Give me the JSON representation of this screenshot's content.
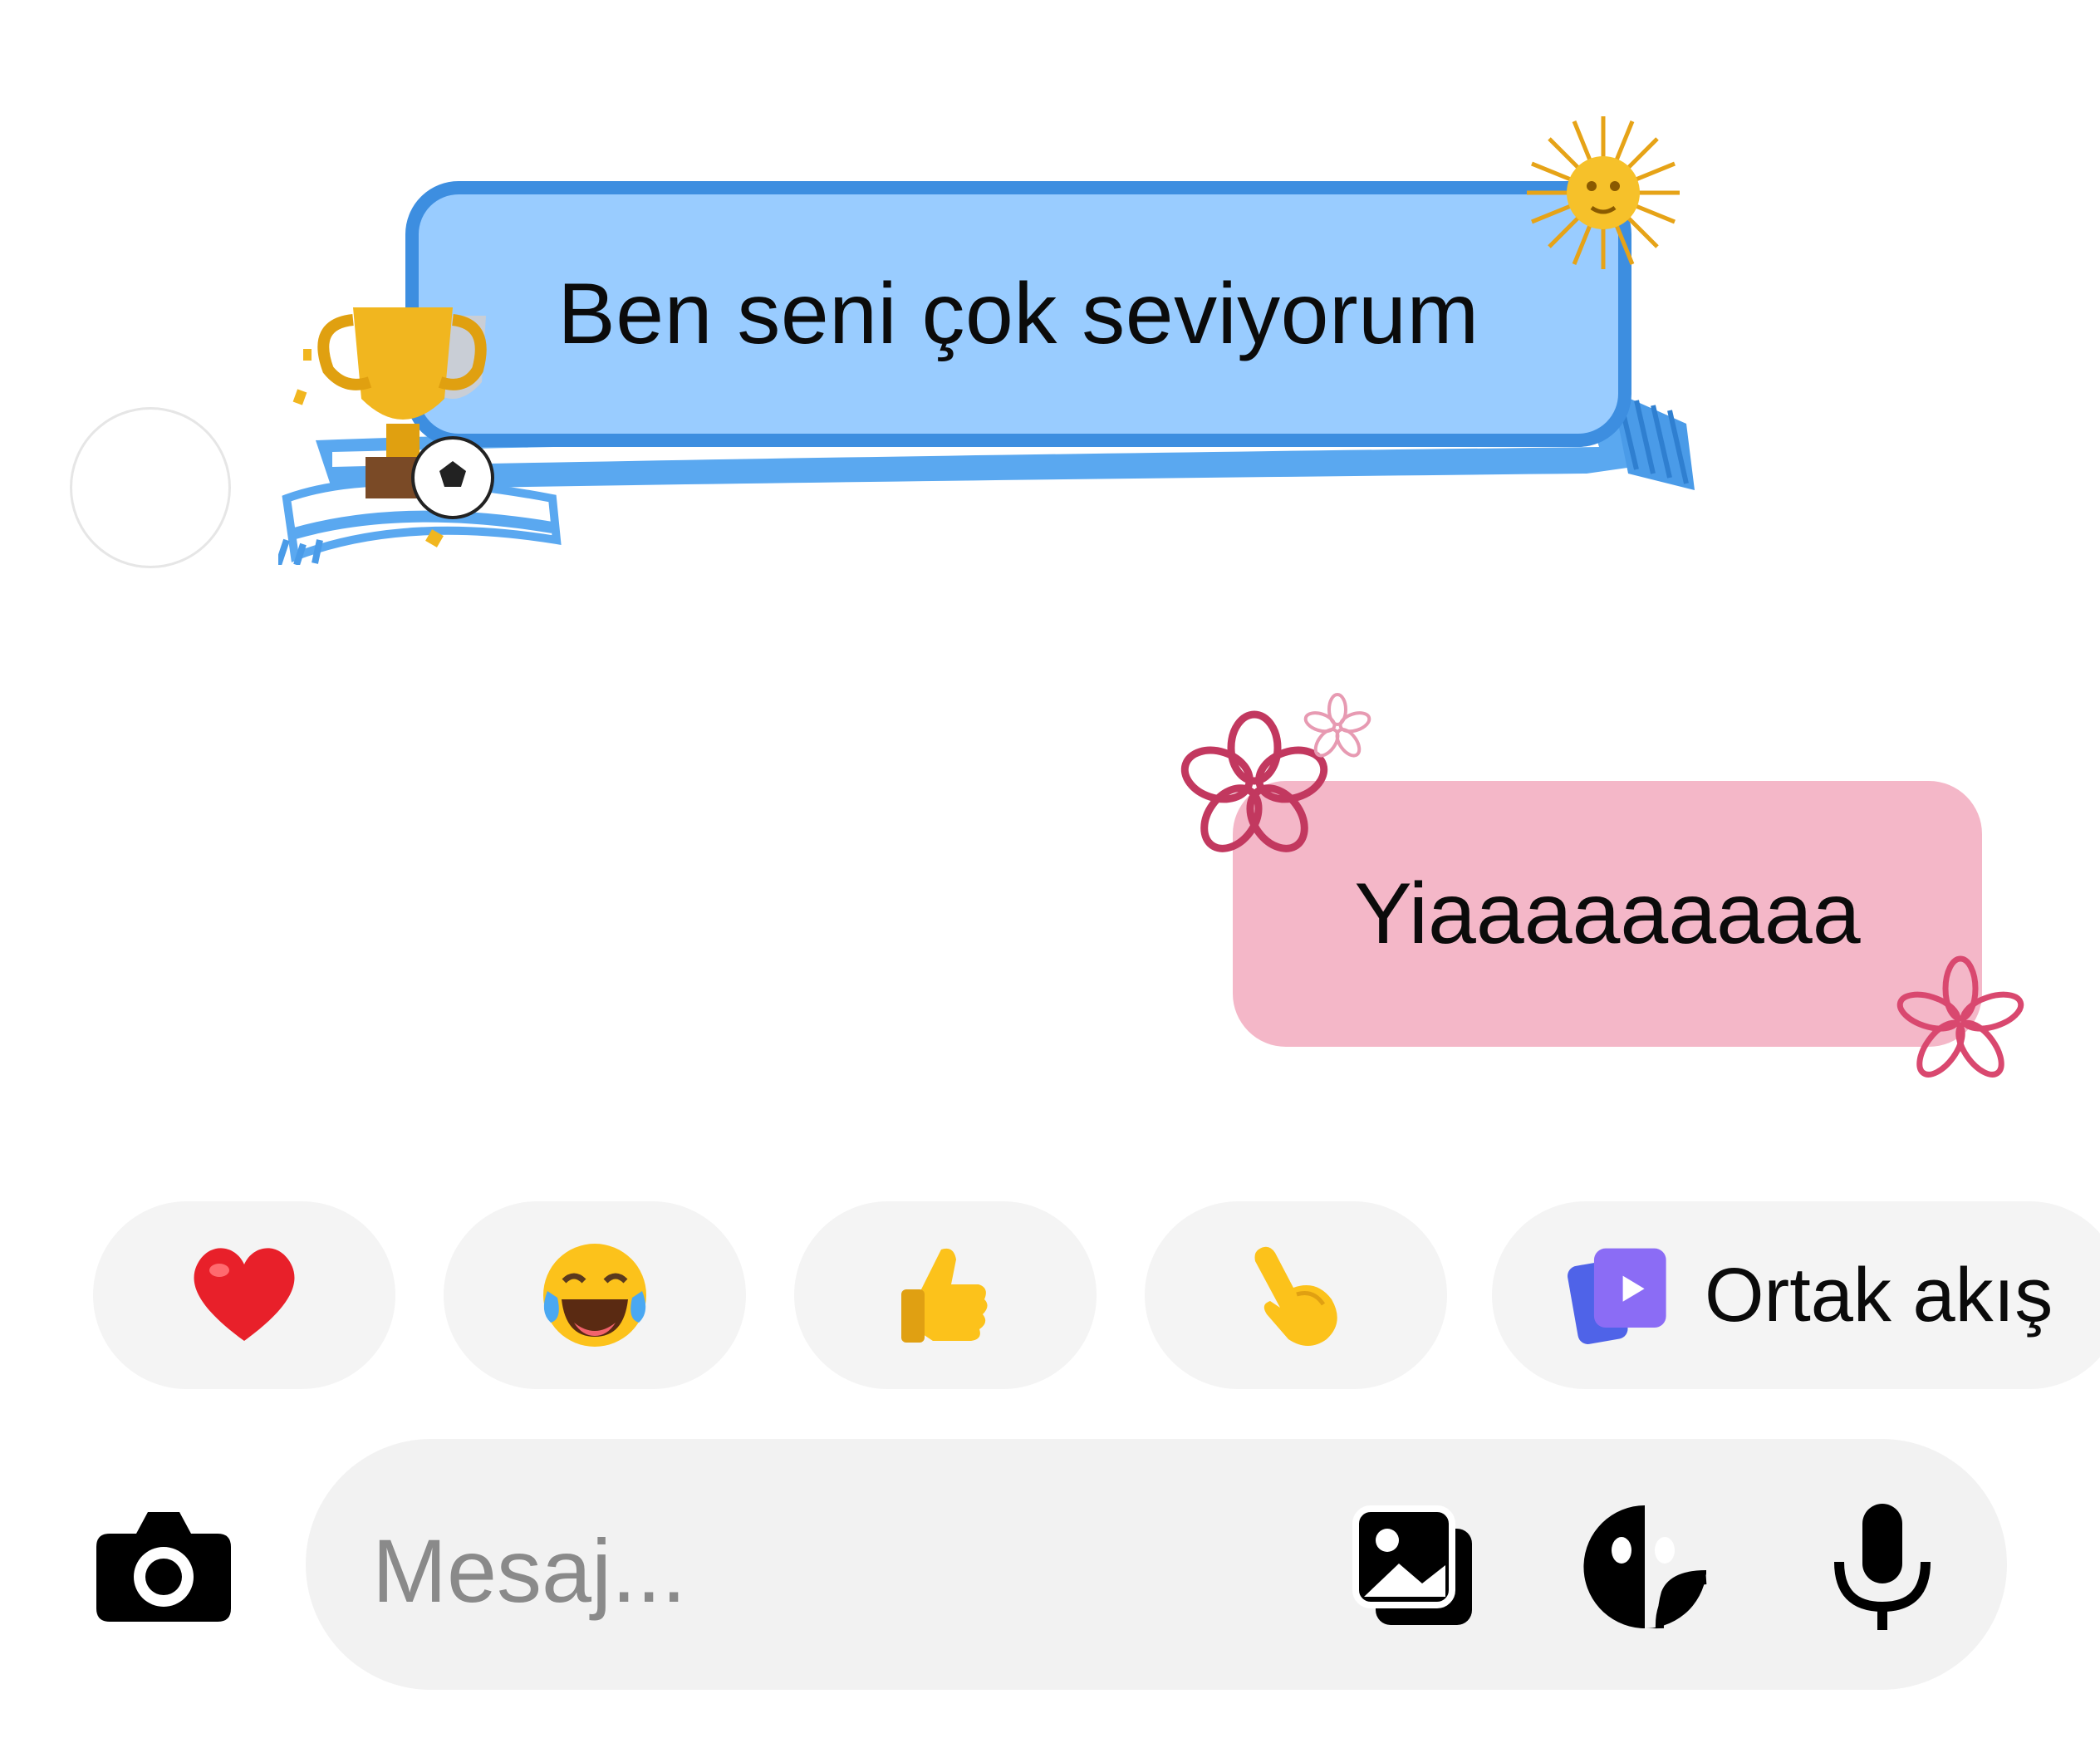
{
  "conversation": {
    "incoming": {
      "text": "Ben seni çok seviyorum"
    },
    "outgoing": {
      "text": "Yiaaaaaaaaa"
    }
  },
  "quick_reactions": [
    {
      "icon": "red-heart-emoji"
    },
    {
      "icon": "tears-of-joy-emoji"
    },
    {
      "icon": "thumbs-up-emoji"
    },
    {
      "icon": "pointing-hand-emoji"
    },
    {
      "icon": "shared-feed-icon",
      "label": "Ortak akış"
    }
  ],
  "composer": {
    "placeholder": "Mesaj...",
    "icons": [
      "camera-icon",
      "gallery-icon",
      "sticker-icon",
      "microphone-icon"
    ]
  },
  "colors": {
    "incoming_fill": "#99ccff",
    "incoming_border": "#3d8ee0",
    "outgoing_fill": "#f4b7c8",
    "chip_bg": "#f4f4f4",
    "composer_bg": "#f2f2f2",
    "feed_icon": "#7b5cf0"
  }
}
